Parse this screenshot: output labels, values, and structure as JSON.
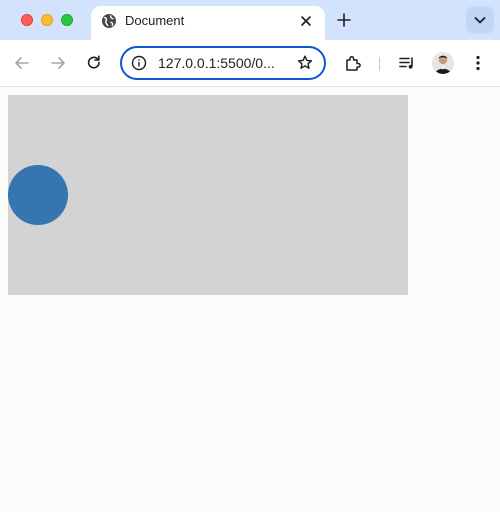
{
  "browser": {
    "tab": {
      "title": "Document",
      "favicon": "globe-icon"
    },
    "address_bar": {
      "url": "127.0.0.1:5500/0..."
    }
  },
  "colors": {
    "tabstrip_bg": "#d3e3fd",
    "omnibox_border": "#0b57d0",
    "stage_bg": "#d3d3d3",
    "ball": "#3575b0"
  },
  "icons": [
    "globe-icon",
    "close-icon",
    "plus-icon",
    "chevron-down-icon",
    "back-arrow-icon",
    "forward-arrow-icon",
    "reload-icon",
    "info-icon",
    "star-icon",
    "extensions-icon",
    "media-queue-icon",
    "avatar",
    "more-vert-icon"
  ]
}
